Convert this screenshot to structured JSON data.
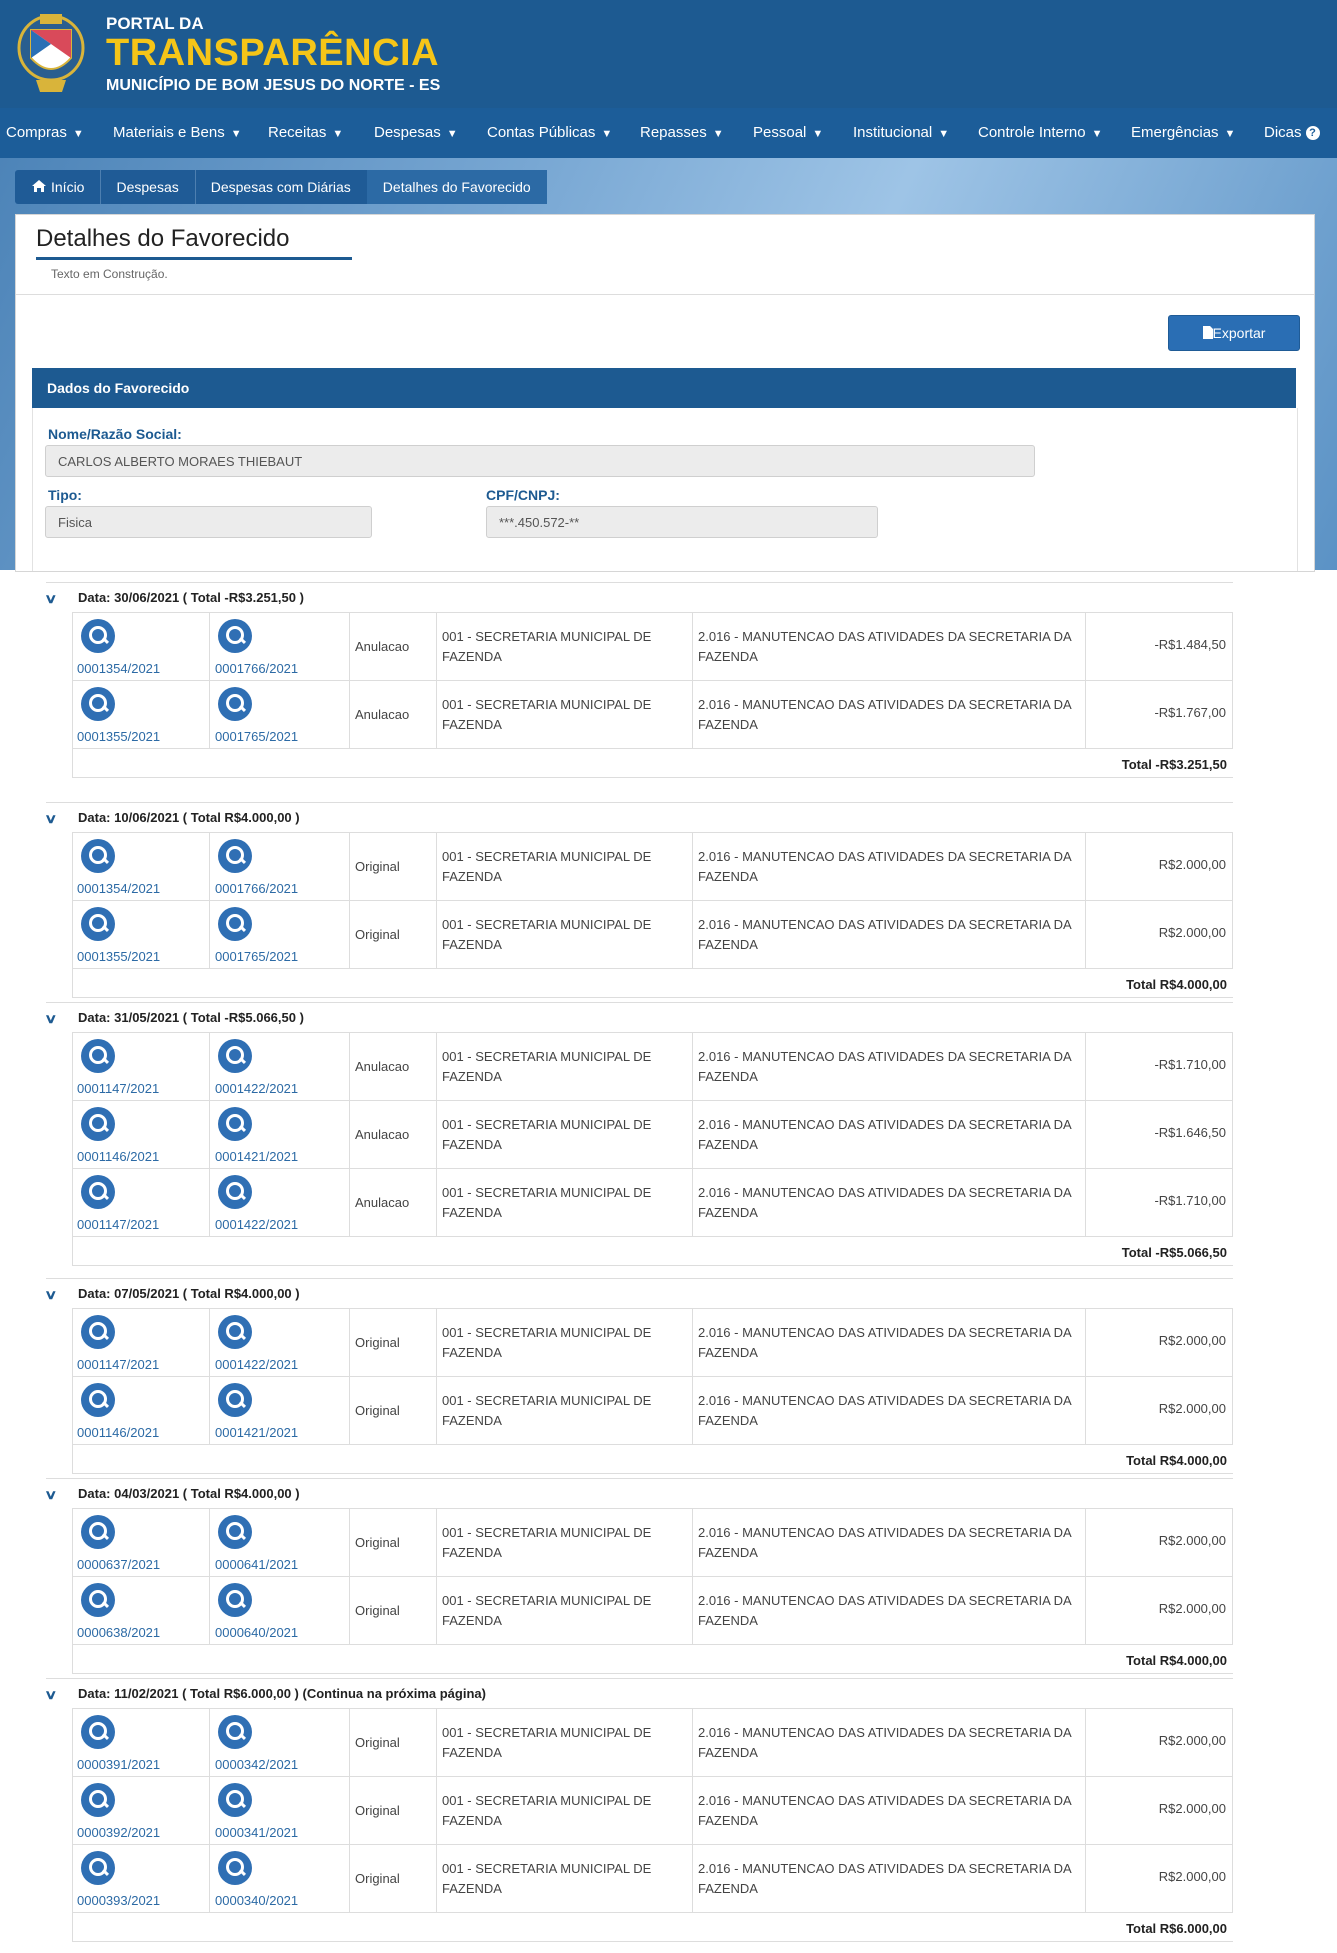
{
  "header": {
    "line1": "PORTAL DA",
    "line2": "TRANSPARÊNCIA",
    "line3": "MUNICÍPIO DE BOM JESUS DO NORTE - ES"
  },
  "nav": [
    "Compras",
    "Materiais e Bens",
    "Receitas",
    "Despesas",
    "Contas Públicas",
    "Repasses",
    "Pessoal",
    "Institucional",
    "Controle Interno",
    "Emergências",
    "Dicas"
  ],
  "breadcrumb": [
    "Início",
    "Despesas",
    "Despesas com Diárias",
    "Detalhes do Favorecido"
  ],
  "page": {
    "title": "Detalhes do Favorecido",
    "description": "Texto em Construção.",
    "export_label": "Exportar"
  },
  "favorecido": {
    "panel_title": "Dados do Favorecido",
    "nome_label": "Nome/Razão Social:",
    "nome_value": "CARLOS ALBERTO MORAES THIEBAUT",
    "tipo_label": "Tipo:",
    "tipo_value": "Fisica",
    "cpf_label": "CPF/CNPJ:",
    "cpf_value": "***.450.572-**"
  },
  "sections": [
    {
      "title": "Data: 30/06/2021 ( Total -R$3.251,50 )",
      "total": "Total -R$3.251,50",
      "rows": [
        {
          "doc1": "0001354/2021",
          "doc2": "0001766/2021",
          "tipo": "Anulacao",
          "orgao": "001 - SECRETARIA MUNICIPAL DE FAZENDA",
          "acao": "2.016 - MANUTENCAO DAS ATIVIDADES DA SECRETARIA DA FAZENDA",
          "valor": "-R$1.484,50"
        },
        {
          "doc1": "0001355/2021",
          "doc2": "0001765/2021",
          "tipo": "Anulacao",
          "orgao": "001 - SECRETARIA MUNICIPAL DE FAZENDA",
          "acao": "2.016 - MANUTENCAO DAS ATIVIDADES DA SECRETARIA DA FAZENDA",
          "valor": "-R$1.767,00"
        }
      ]
    },
    {
      "title": "Data: 10/06/2021 ( Total R$4.000,00 )",
      "total": "Total R$4.000,00",
      "rows": [
        {
          "doc1": "0001354/2021",
          "doc2": "0001766/2021",
          "tipo": "Original",
          "orgao": "001 - SECRETARIA MUNICIPAL DE FAZENDA",
          "acao": "2.016 - MANUTENCAO DAS ATIVIDADES DA SECRETARIA DA FAZENDA",
          "valor": "R$2.000,00"
        },
        {
          "doc1": "0001355/2021",
          "doc2": "0001765/2021",
          "tipo": "Original",
          "orgao": "001 - SECRETARIA MUNICIPAL DE FAZENDA",
          "acao": "2.016 - MANUTENCAO DAS ATIVIDADES DA SECRETARIA DA FAZENDA",
          "valor": "R$2.000,00"
        }
      ]
    },
    {
      "title": "Data: 31/05/2021 ( Total -R$5.066,50 )",
      "total": "Total -R$5.066,50",
      "rows": [
        {
          "doc1": "0001147/2021",
          "doc2": "0001422/2021",
          "tipo": "Anulacao",
          "orgao": "001 - SECRETARIA MUNICIPAL DE FAZENDA",
          "acao": "2.016 - MANUTENCAO DAS ATIVIDADES DA SECRETARIA DA FAZENDA",
          "valor": "-R$1.710,00"
        },
        {
          "doc1": "0001146/2021",
          "doc2": "0001421/2021",
          "tipo": "Anulacao",
          "orgao": "001 - SECRETARIA MUNICIPAL DE FAZENDA",
          "acao": "2.016 - MANUTENCAO DAS ATIVIDADES DA SECRETARIA DA FAZENDA",
          "valor": "-R$1.646,50"
        },
        {
          "doc1": "0001147/2021",
          "doc2": "0001422/2021",
          "tipo": "Anulacao",
          "orgao": "001 - SECRETARIA MUNICIPAL DE FAZENDA",
          "acao": "2.016 - MANUTENCAO DAS ATIVIDADES DA SECRETARIA DA FAZENDA",
          "valor": "-R$1.710,00"
        }
      ]
    },
    {
      "title": "Data: 07/05/2021 ( Total R$4.000,00 )",
      "total": "Total R$4.000,00",
      "rows": [
        {
          "doc1": "0001147/2021",
          "doc2": "0001422/2021",
          "tipo": "Original",
          "orgao": "001 - SECRETARIA MUNICIPAL DE FAZENDA",
          "acao": "2.016 - MANUTENCAO DAS ATIVIDADES DA SECRETARIA DA FAZENDA",
          "valor": "R$2.000,00"
        },
        {
          "doc1": "0001146/2021",
          "doc2": "0001421/2021",
          "tipo": "Original",
          "orgao": "001 - SECRETARIA MUNICIPAL DE FAZENDA",
          "acao": "2.016 - MANUTENCAO DAS ATIVIDADES DA SECRETARIA DA FAZENDA",
          "valor": "R$2.000,00"
        }
      ]
    },
    {
      "title": "Data: 04/03/2021 ( Total R$4.000,00 )",
      "total": "Total R$4.000,00",
      "rows": [
        {
          "doc1": "0000637/2021",
          "doc2": "0000641/2021",
          "tipo": "Original",
          "orgao": "001 - SECRETARIA MUNICIPAL DE FAZENDA",
          "acao": "2.016 - MANUTENCAO DAS ATIVIDADES DA SECRETARIA DA FAZENDA",
          "valor": "R$2.000,00"
        },
        {
          "doc1": "0000638/2021",
          "doc2": "0000640/2021",
          "tipo": "Original",
          "orgao": "001 - SECRETARIA MUNICIPAL DE FAZENDA",
          "acao": "2.016 - MANUTENCAO DAS ATIVIDADES DA SECRETARIA DA FAZENDA",
          "valor": "R$2.000,00"
        }
      ]
    },
    {
      "title": "Data: 11/02/2021 ( Total R$6.000,00 ) (Continua na próxima página)",
      "total": "Total R$6.000,00",
      "rows": [
        {
          "doc1": "0000391/2021",
          "doc2": "0000342/2021",
          "tipo": "Original",
          "orgao": "001 - SECRETARIA MUNICIPAL DE FAZENDA",
          "acao": "2.016 - MANUTENCAO DAS ATIVIDADES DA SECRETARIA DA FAZENDA",
          "valor": "R$2.000,00"
        },
        {
          "doc1": "0000392/2021",
          "doc2": "0000341/2021",
          "tipo": "Original",
          "orgao": "001 - SECRETARIA MUNICIPAL DE FAZENDA",
          "acao": "2.016 - MANUTENCAO DAS ATIVIDADES DA SECRETARIA DA FAZENDA",
          "valor": "R$2.000,00"
        },
        {
          "doc1": "0000393/2021",
          "doc2": "0000340/2021",
          "tipo": "Original",
          "orgao": "001 - SECRETARIA MUNICIPAL DE FAZENDA",
          "acao": "2.016 - MANUTENCAO DAS ATIVIDADES DA SECRETARIA DA FAZENDA",
          "valor": "R$2.000,00"
        }
      ]
    }
  ]
}
